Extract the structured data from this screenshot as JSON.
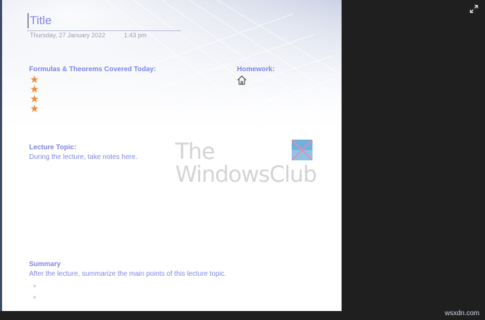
{
  "page": {
    "title": "Title",
    "date": "Thursday, 27 January 2022",
    "time": "1:43 pm"
  },
  "sections": {
    "formulas": {
      "heading": "Formulas & Theorems Covered Today:",
      "items_count": 4
    },
    "homework": {
      "heading": "Homework:"
    },
    "lecture": {
      "heading": "Lecture Topic:",
      "body": "During the lecture, take notes here."
    },
    "summary": {
      "heading": "Summary",
      "body": "After the lecture, summarize the main points of this lecture topic."
    }
  },
  "watermark": {
    "line1": "The",
    "line2": "WindowsClub"
  },
  "footer": {
    "site": "wsxdn.com"
  },
  "icons": {
    "star": "star-icon",
    "home": "home-icon",
    "expand": "expand-icon"
  },
  "colors": {
    "heading": "#7d86e6",
    "star": "#f08a3a",
    "background": "#1f1f1f"
  }
}
